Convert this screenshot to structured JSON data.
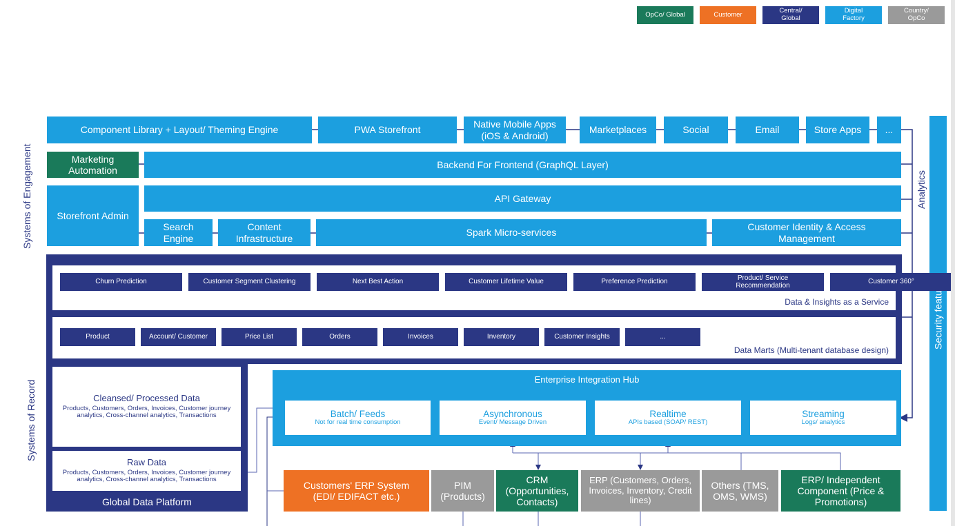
{
  "legend": [
    {
      "label": "OpCo/ Global",
      "color": "#1a7a5a"
    },
    {
      "label": "Customer",
      "color": "#ee7124"
    },
    {
      "label": "Central/ Global",
      "color": "#2b3784"
    },
    {
      "label": "Digital Factory",
      "color": "#1c9fdf"
    },
    {
      "label": "Country/ OpCo",
      "color": "#9a9a9a"
    }
  ],
  "side_labels": {
    "engagement": "Systems of Engagement",
    "record": "Systems of Record",
    "analytics": "Analytics",
    "security": "Security features"
  },
  "channels": [
    "Component Library + Layout/ Theming Engine",
    "PWA Storefront",
    "Native Mobile Apps (iOS & Android)",
    "Marketplaces",
    "Social",
    "Email",
    "Store Apps",
    "..."
  ],
  "engagement": {
    "marketing_automation": "Marketing Automation",
    "bff": "Backend For Frontend (GraphQL Layer)",
    "storefront_admin": "Storefront Admin",
    "api_gateway": "API Gateway",
    "search_engine": "Search Engine",
    "content_infrastructure": "Content Infrastructure",
    "spark": "Spark Micro-services",
    "ciam": "Customer Identity & Access Management"
  },
  "insights": {
    "title": "Data & Insights as a Service",
    "items": [
      "Churn Prediction",
      "Customer Segment Clustering",
      "Next Best Action",
      "Customer Lifetime Value",
      "Preference Prediction",
      "Product/ Service Recommendation",
      "Customer 360°",
      "..."
    ]
  },
  "data_marts": {
    "title": "Data Marts (Multi-tenant database design)",
    "items": [
      "Product",
      "Account/ Customer",
      "Price List",
      "Orders",
      "Invoices",
      "Inventory",
      "Customer Insights",
      "..."
    ]
  },
  "global_data_platform": {
    "title": "Global Data Platform",
    "cleansed": {
      "title": "Cleansed/ Processed Data",
      "desc": "Products, Customers, Orders, Invoices, Customer journey analytics, Cross-channel analytics, Transactions"
    },
    "raw": {
      "title": "Raw Data",
      "desc": "Products, Customers, Orders, Invoices, Customer journey analytics, Cross-channel analytics, Transactions"
    }
  },
  "integration_hub": {
    "title": "Enterprise Integration Hub",
    "modes": [
      {
        "title": "Batch/ Feeds",
        "desc": "Not for real time consumption"
      },
      {
        "title": "Asynchronous",
        "desc": "Event/ Message Driven"
      },
      {
        "title": "Realtime",
        "desc": "APIs based (SOAP/ REST)"
      },
      {
        "title": "Streaming",
        "desc": "Logs/ analytics"
      }
    ]
  },
  "backends": [
    {
      "label": "Customers' ERP System (EDI/ EDIFACT etc.)"
    },
    {
      "label": "PIM (Products)"
    },
    {
      "label": "CRM (Opportunities, Contacts)"
    },
    {
      "label": "ERP (Customers, Orders, Invoices, Inventory, Credit lines)"
    },
    {
      "label": "Others (TMS, OMS, WMS)"
    },
    {
      "label": "ERP/ Independent Component (Price & Promotions)"
    }
  ]
}
